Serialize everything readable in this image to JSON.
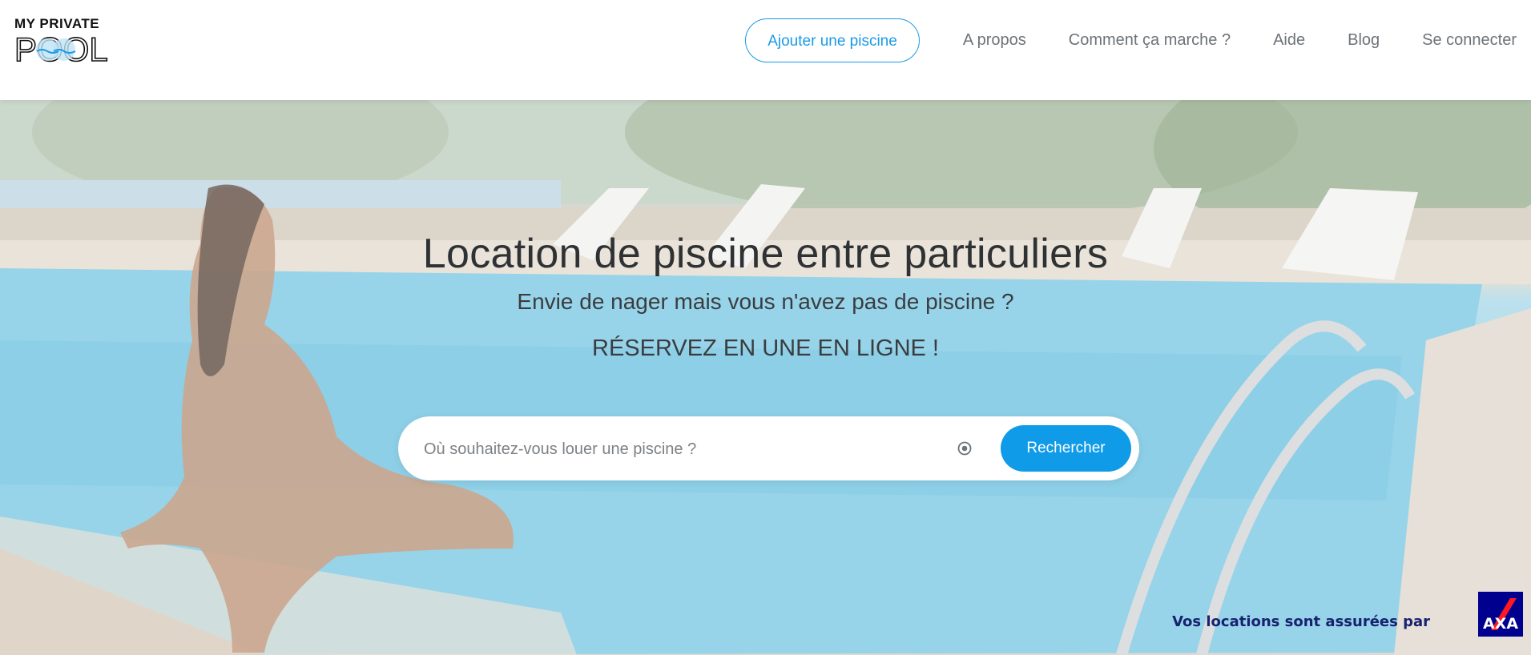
{
  "header": {
    "logo_top": "MY PRIVATE",
    "logo_bottom": "POOL",
    "nav": {
      "add_pool": "Ajouter une piscine",
      "about": "A propos",
      "how_it_works": "Comment ça marche ?",
      "help": "Aide",
      "blog": "Blog",
      "login": "Se connecter"
    }
  },
  "hero": {
    "title": "Location de piscine entre particuliers",
    "subtitle": "Envie de nager mais vous n'avez pas de piscine ?",
    "cta": "RÉSERVEZ EN UNE EN LIGNE !",
    "search": {
      "placeholder": "Où souhaitez-vous louer une piscine ?",
      "button": "Rechercher",
      "locate_icon": "target-icon"
    },
    "insurance_text": "Vos locations sont assurées par",
    "insurance_logo": "AXA"
  },
  "colors": {
    "accent": "#0f9be8",
    "nav_text": "#6d7378",
    "axa_blue": "#00008f",
    "axa_red": "#ff1721",
    "axa_text": "#18226f"
  }
}
